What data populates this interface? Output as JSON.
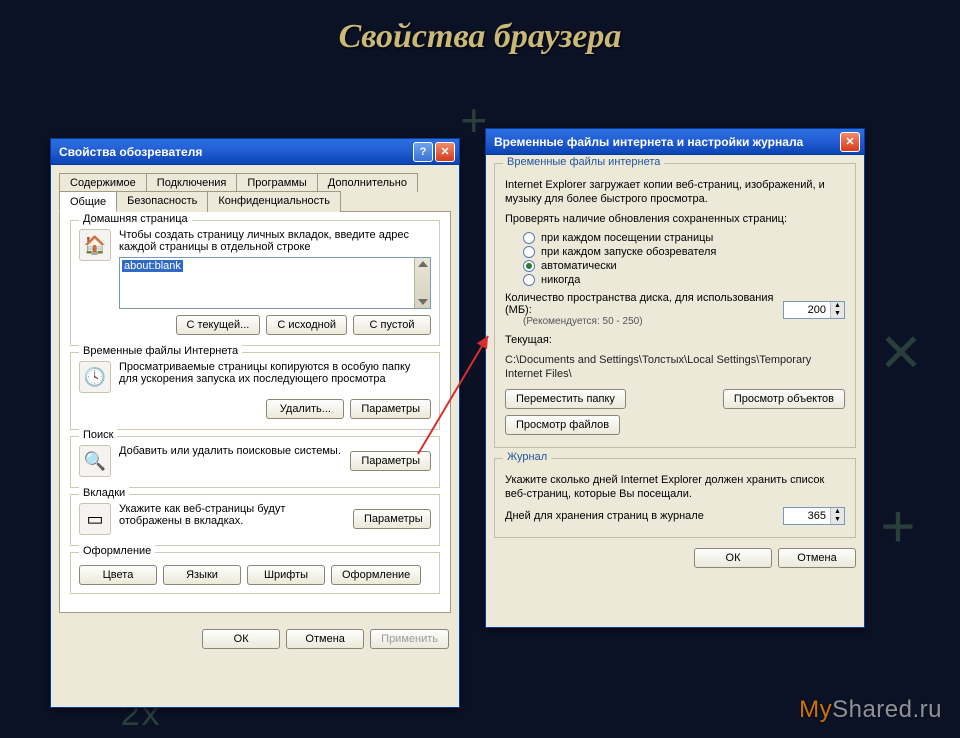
{
  "slide": {
    "title": "Свойства браузера"
  },
  "watermark": {
    "a": "My",
    "b": "Shared.ru"
  },
  "props": {
    "title": "Свойства обозревателя",
    "tabs_top": [
      "Содержимое",
      "Подключения",
      "Программы",
      "Дополнительно"
    ],
    "tabs_bottom": [
      "Общие",
      "Безопасность",
      "Конфиденциальность"
    ],
    "active_tab": "Общие",
    "home": {
      "legend": "Домашняя страница",
      "desc": "Чтобы создать страницу личных вкладок, введите адрес каждой страницы в отдельной строке",
      "value": "about:blank",
      "btn_current": "С текущей...",
      "btn_default": "С исходной",
      "btn_blank": "С пустой"
    },
    "tmp": {
      "legend": "Временные файлы Интернета",
      "desc": "Просматриваемые страницы копируются в особую папку для ускорения запуска их последующего просмотра",
      "btn_delete": "Удалить...",
      "btn_options": "Параметры"
    },
    "search": {
      "legend": "Поиск",
      "desc": "Добавить или удалить поисковые системы.",
      "btn": "Параметры"
    },
    "tabs": {
      "legend": "Вкладки",
      "desc": "Укажите как веб-страницы будут отображены в вкладках.",
      "btn": "Параметры"
    },
    "appearance": {
      "legend": "Оформление",
      "btns": [
        "Цвета",
        "Языки",
        "Шрифты",
        "Оформление"
      ]
    },
    "ok": "ОК",
    "cancel": "Отмена",
    "apply": "Применить"
  },
  "temp": {
    "title": "Временные файлы интернета и настройки журнала",
    "tif": {
      "legend": "Временные файлы интернета",
      "line1": "Internet Explorer загружает копии веб-страниц, изображений, и музыку для более быстрого просмотра.",
      "check_label": "Проверять наличие обновления сохраненных страниц:",
      "radios": [
        "при каждом посещении страницы",
        "при каждом запуске обозревателя",
        "автоматически",
        "никогда"
      ],
      "selected_radio": 2,
      "disk_label": "Количество пространства диска, для использования (МБ):",
      "disk_hint": "(Рекомендуется: 50 - 250)",
      "disk_value": "200",
      "current_label": "Текущая:",
      "current_path": "C:\\Documents and Settings\\Толстых\\Local Settings\\Temporary Internet Files\\",
      "btn_move": "Переместить папку",
      "btn_viewobj": "Просмотр объектов",
      "btn_viewfiles": "Просмотр файлов"
    },
    "hist": {
      "legend": "Журнал",
      "desc": "Укажите сколько дней Internet Explorer должен хранить список веб-страниц, которые Вы посещали.",
      "days_label": "Дней для хранения страниц в журнале",
      "days_value": "365"
    },
    "ok": "ОК",
    "cancel": "Отмена"
  }
}
